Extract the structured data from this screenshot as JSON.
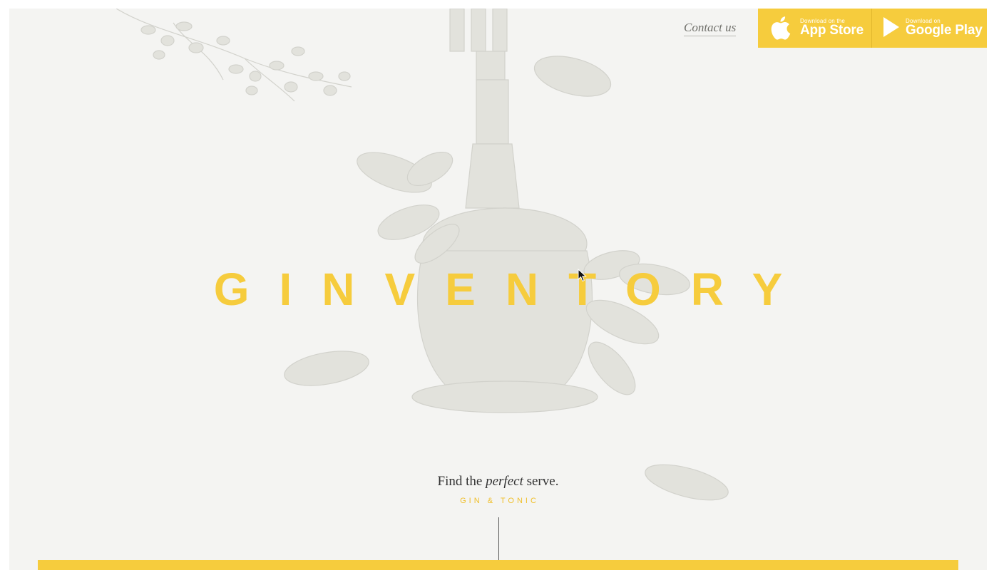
{
  "header": {
    "contact_label": "Contact us",
    "app_store": {
      "small": "Download on the",
      "big": "App Store",
      "icon": "apple-icon"
    },
    "google_play": {
      "small": "Download on",
      "big": "Google Play",
      "icon": "play-icon"
    }
  },
  "hero": {
    "brand": "GINVENTORY",
    "tagline_before": "Find the ",
    "tagline_emph": "perfect",
    "tagline_after": " serve.",
    "subtag": "GIN & TONIC"
  },
  "colors": {
    "accent": "#f6cc3d",
    "background": "#f4f4f2",
    "illustration": "#dcdcd6",
    "text": "#333333"
  }
}
